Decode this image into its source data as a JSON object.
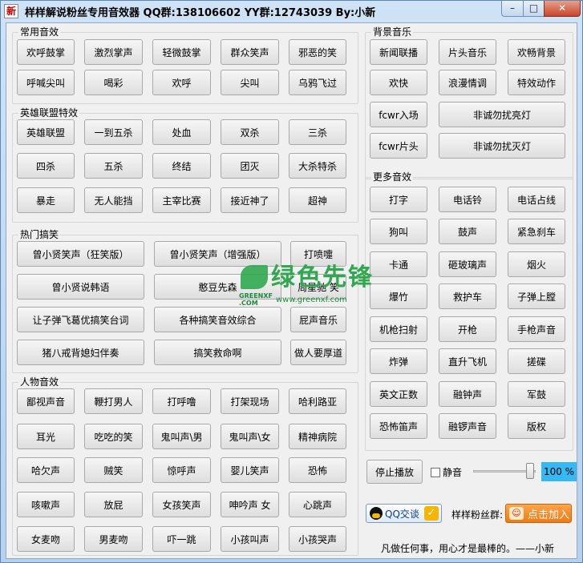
{
  "window": {
    "title": "样样解说粉丝专用音效器  QQ群:138106602  YY群:12743039  By:小新",
    "icon_char": "新",
    "min_glyph": "–",
    "max_glyph": "□",
    "close_glyph": "✕"
  },
  "groups": {
    "common": {
      "title": "常用音效",
      "buttons": [
        "欢呼鼓掌",
        "激烈掌声",
        "轻微鼓掌",
        "群众笑声",
        "邪恶的笑",
        "呼喊尖叫",
        "喝彩",
        "欢呼",
        "尖叫",
        "乌鸦飞过"
      ]
    },
    "lol": {
      "title": "英雄联盟特效",
      "buttons": [
        "英雄联盟",
        "一到五杀",
        "处血",
        "双杀",
        "三杀",
        "四杀",
        "五杀",
        "终结",
        "团灭",
        "大杀特杀",
        "暴走",
        "无人能挡",
        "主宰比赛",
        "接近神了",
        "超神"
      ]
    },
    "funny": {
      "title": "热门搞笑",
      "buttons": [
        "曾小贤笑声（狂笑版）",
        "曾小贤笑声（增强版）",
        "打喷嚏",
        "曾小贤说韩语",
        "憨豆先森",
        "周星驰 笑",
        "让子弹飞葛优搞笑台词",
        "各种搞笑音效综合",
        "屁声音乐",
        "猪八戒背媳妇伴奏",
        "搞笑救命啊",
        "做人要厚道"
      ]
    },
    "people": {
      "title": "人物音效",
      "buttons": [
        "鄙视声音",
        "鞭打男人",
        "打呼噜",
        "打架现场",
        "哈利路亚",
        "耳光",
        "吃吃的笑",
        "鬼叫声\\男",
        "鬼叫声\\女",
        "精神病院",
        "哈欠声",
        "贼笑",
        "惊呼声",
        "婴儿笑声",
        "恐怖",
        "咳嗽声",
        "放屁",
        "女孩笑声",
        "呻吟声 女",
        "心跳声",
        "女麦吻",
        "男麦吻",
        "吓一跳",
        "小孩叫声",
        "小孩哭声"
      ]
    },
    "bgm": {
      "title": "背景音乐",
      "buttons": [
        "新闻联播",
        "片头音乐",
        "欢畅背景",
        "欢快",
        "浪漫情调",
        "特效动作",
        "fcwr入场",
        "非诚勿扰亮灯",
        "fcwr片头",
        "非诚勿扰灭灯"
      ]
    },
    "more": {
      "title": "更多音效",
      "buttons": [
        "打字",
        "电话铃",
        "电话占线",
        "狗叫",
        "鼓声",
        "紧急刹车",
        "卡通",
        "砸玻璃声",
        "烟火",
        "爆竹",
        "救护车",
        "子弹上膛",
        "机枪扫射",
        "开枪",
        "手枪声音",
        "炸弹",
        "直升飞机",
        "搓碟",
        "英文正数",
        "融钟声",
        "军鼓",
        "恐怖笛声",
        "融锣声音",
        "版权"
      ]
    }
  },
  "controls": {
    "stop_label": "停止播放",
    "mute_label": "静音",
    "mute_checked": false,
    "volume_label": "100 %",
    "volume_value": 100,
    "qq_label": "QQ交谈",
    "qq_check_glyph": "✓",
    "fan_group_label": "样样粉丝群:",
    "join_label": "点击加入",
    "join_icon_glyph": "☺",
    "motto": "凡做任何事，用心才是最棒的。——小新"
  },
  "watermark": {
    "brand": "绿色先锋",
    "small": "GREENXF\n.COM",
    "url": "www.greenxf.com"
  }
}
